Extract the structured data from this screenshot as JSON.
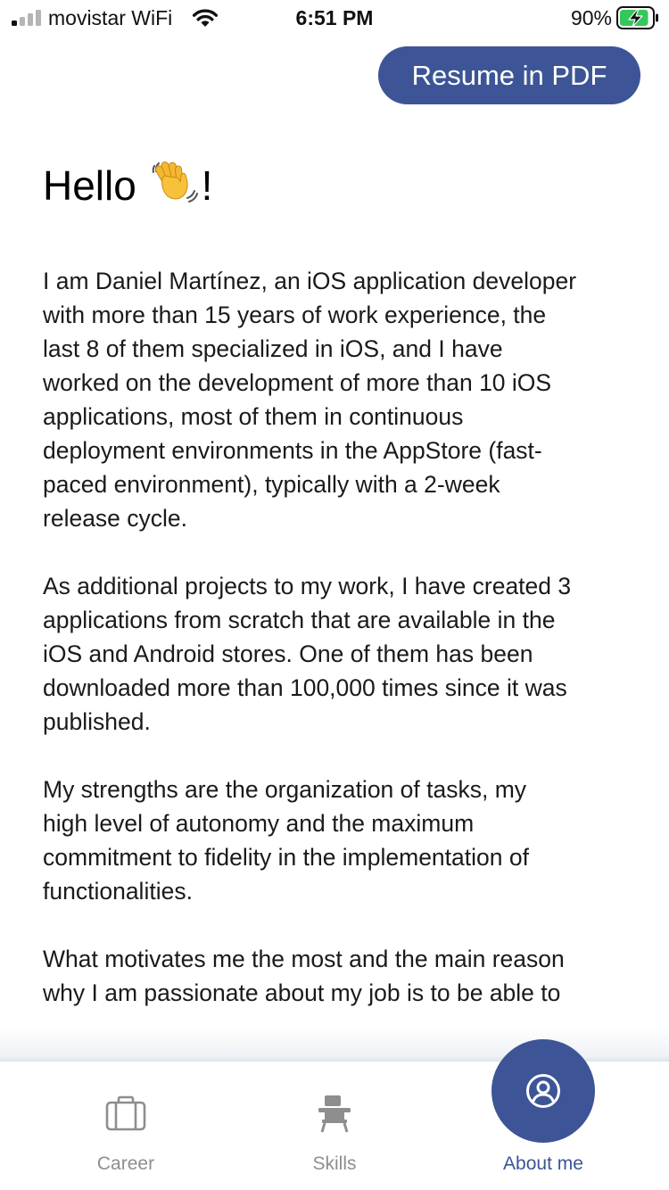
{
  "status_bar": {
    "carrier": "movistar WiFi",
    "time": "6:51 PM",
    "battery_percent": "90%",
    "battery_level": 0.9,
    "battery_charging": true
  },
  "header": {
    "resume_button_label": "Resume in PDF"
  },
  "about": {
    "greeting_prefix": "Hello",
    "greeting_suffix": "!",
    "greeting_icon": "waving-hand-icon",
    "paragraphs": [
      "I am Daniel Martínez, an iOS application developer\nwith more than 15 years of work experience, the\nlast 8 of them specialized in iOS, and I have\nworked on the development of more than 10 iOS\napplications, most of them in continuous\ndeployment environments in the AppStore (fast-\npaced environment), typically with a 2-week\nrelease cycle.",
      "As additional projects to my work, I have created 3\napplications from scratch that are available in the\niOS and Android stores. One of them has been\ndownloaded more than 100,000 times since it was\npublished.",
      "My strengths are the organization of tasks, my\nhigh level of autonomy and the maximum\ncommitment to fidelity in the implementation of\nfunctionalities.",
      "What motivates me the most and the main reason\nwhy I am passionate about my job is to be able to\nreach out and help anyone who owns a mobile"
    ]
  },
  "tab_bar": {
    "tabs": [
      {
        "label": "Career",
        "icon": "briefcase-icon",
        "active": false
      },
      {
        "label": "Skills",
        "icon": "school-desk-icon",
        "active": false
      },
      {
        "label": "About me",
        "icon": "user-circle-icon",
        "active": true
      }
    ]
  },
  "colors": {
    "accent": "#3d5596",
    "inactive_tab": "#8e8e8e",
    "battery_fill": "#34c759"
  }
}
